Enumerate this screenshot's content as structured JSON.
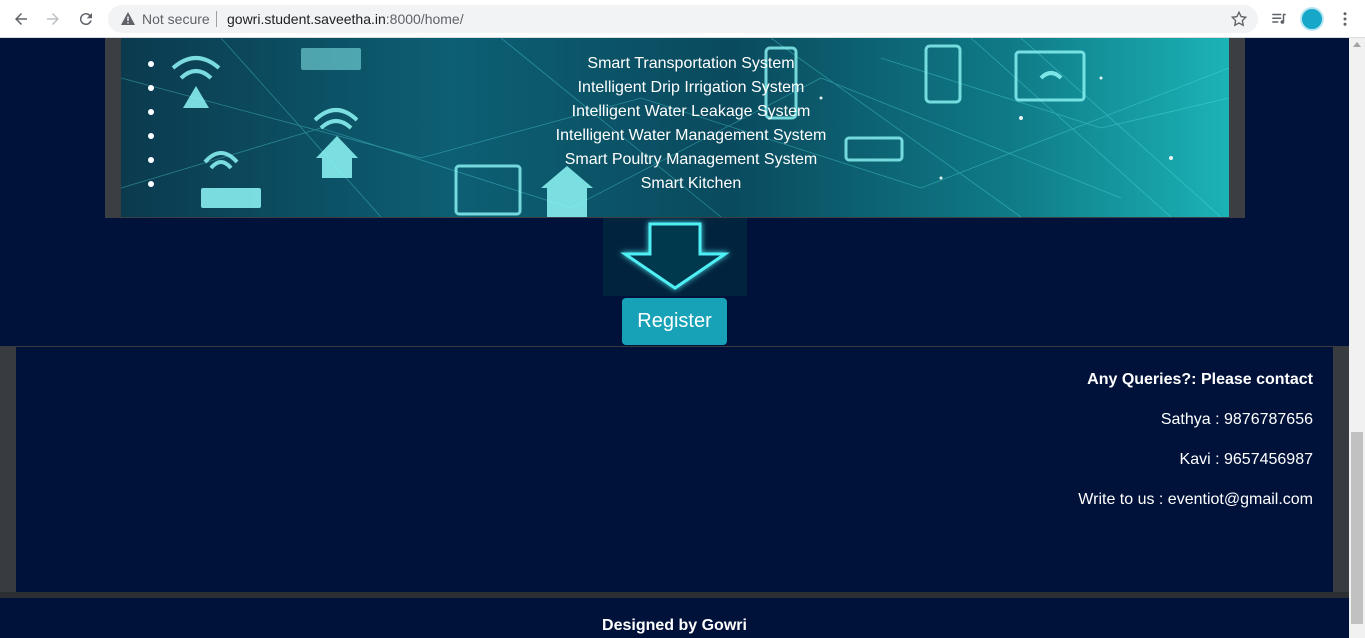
{
  "browser": {
    "security_label": "Not secure",
    "url_host": "gowri.student.saveetha.in",
    "url_rest": ":8000/home/",
    "icons": [
      "back-icon",
      "forward-icon",
      "reload-icon",
      "warning-icon",
      "star-icon",
      "media-queue-icon",
      "profile-avatar",
      "menu-dots-icon"
    ]
  },
  "banner": {
    "items": [
      "Smart Transportation System",
      "Intelligent Drip Irrigation System",
      "Intelligent Water Leakage System",
      "Intelligent Water Management System",
      "Smart Poultry Management System",
      "Smart Kitchen"
    ]
  },
  "register": {
    "label": "Register"
  },
  "contact": {
    "title": "Any Queries?: Please contact",
    "line1": "Sathya : 9876787656",
    "line2": "Kavi : 9657456987",
    "line3": "Write to us : eventiot@gmail.com"
  },
  "footer": {
    "credit": "Designed by Gowri"
  },
  "colors": {
    "page_bg": "#00123a",
    "button": "#17a2b8",
    "frame": "#3b3f44"
  }
}
